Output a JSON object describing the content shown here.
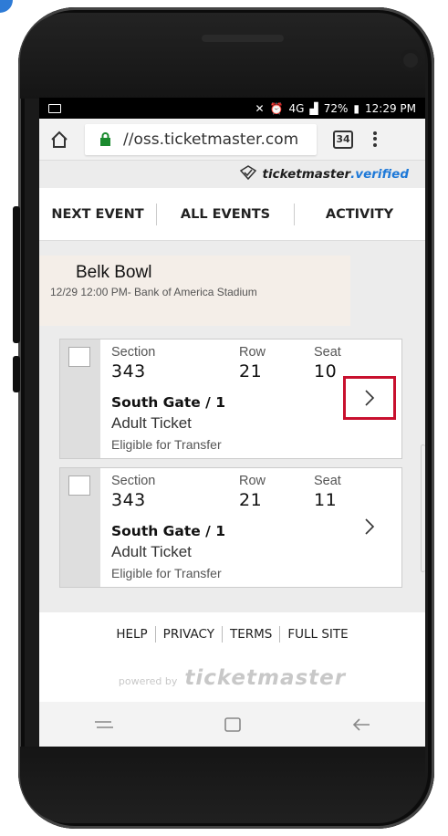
{
  "status_bar": {
    "battery": "72%",
    "time": "12:29 PM",
    "signal": "4G"
  },
  "browser": {
    "url": "//oss.ticketmaster.com",
    "tab_count": "34"
  },
  "verified": {
    "brand": "ticketmaster",
    "suffix": ".verified"
  },
  "nav": {
    "items": [
      {
        "label": "NEXT EVENT"
      },
      {
        "label": "ALL EVENTS"
      },
      {
        "label": "ACTIVITY"
      }
    ]
  },
  "event": {
    "title": "Belk Bowl",
    "subtitle": "12/29 12:00 PM- Bank of America Stadium"
  },
  "ticket_labels": {
    "section": "Section",
    "row": "Row",
    "seat": "Seat"
  },
  "tickets": [
    {
      "section": "343",
      "row": "21",
      "seat": "10",
      "gate": "South Gate / 1",
      "type": "Adult Ticket",
      "transfer": "Eligible for Transfer",
      "highlighted": true
    },
    {
      "section": "343",
      "row": "21",
      "seat": "11",
      "gate": "South Gate / 1",
      "type": "Adult Ticket",
      "transfer": "Eligible for Transfer",
      "highlighted": false
    }
  ],
  "footer": {
    "links": [
      {
        "label": "HELP"
      },
      {
        "label": "PRIVACY"
      },
      {
        "label": "TERMS"
      },
      {
        "label": "FULL SITE"
      }
    ],
    "powered_by": "powered by",
    "brand": "ticketmaster"
  },
  "colors": {
    "highlight": "#c8102e",
    "verified_blue": "#1e79d8"
  },
  "icons": {
    "home": "home-icon",
    "lock": "lock-icon",
    "menu": "overflow-menu-icon",
    "chevron": "chevron-right-icon",
    "recent_apps": "recent-apps-icon",
    "home_button": "home-button-icon",
    "back": "back-icon"
  }
}
